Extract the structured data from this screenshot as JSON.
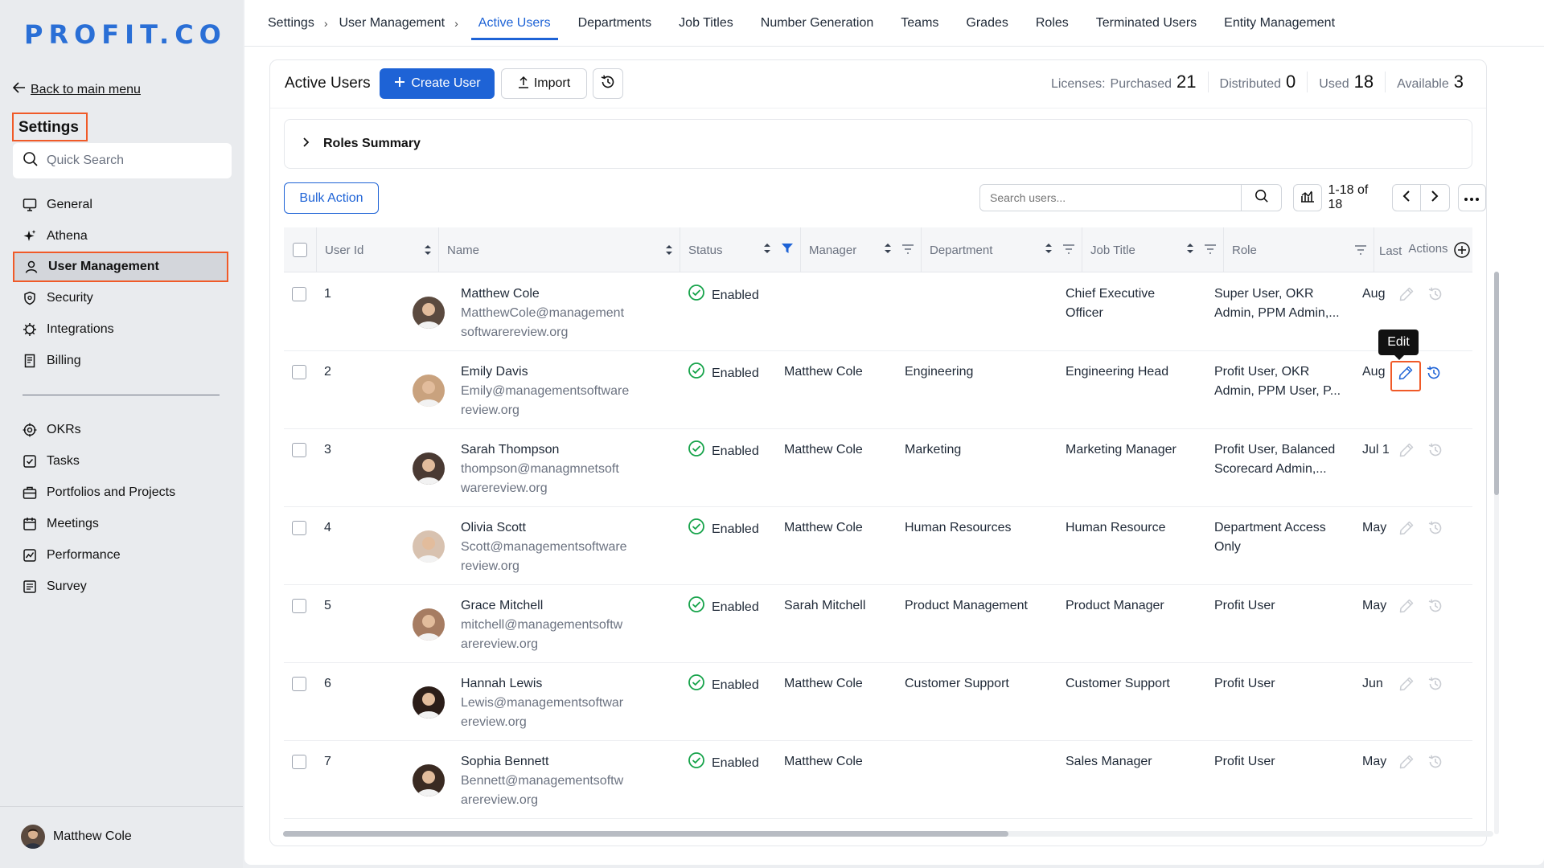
{
  "sidebar": {
    "logo": "PROFIT.CO",
    "back_label": "Back to main menu",
    "title": "Settings",
    "search_placeholder": "Quick Search",
    "items_top": [
      {
        "label": "General",
        "icon": "monitor-icon"
      },
      {
        "label": "Athena",
        "icon": "sparkle-icon"
      },
      {
        "label": "User Management",
        "icon": "user-icon",
        "active": true
      },
      {
        "label": "Security",
        "icon": "shield-icon"
      },
      {
        "label": "Integrations",
        "icon": "gear-icon"
      },
      {
        "label": "Billing",
        "icon": "receipt-icon"
      }
    ],
    "items_bottom": [
      {
        "label": "OKRs",
        "icon": "target-icon"
      },
      {
        "label": "Tasks",
        "icon": "checkbox-icon"
      },
      {
        "label": "Portfolios and Projects",
        "icon": "briefcase-icon"
      },
      {
        "label": "Meetings",
        "icon": "calendar-icon"
      },
      {
        "label": "Performance",
        "icon": "chart-icon"
      },
      {
        "label": "Survey",
        "icon": "survey-icon"
      }
    ],
    "footer_user": "Matthew Cole"
  },
  "breadcrumb": [
    "Settings",
    "User Management"
  ],
  "tabs": [
    {
      "label": "Active Users",
      "active": true
    },
    {
      "label": "Departments"
    },
    {
      "label": "Job Titles"
    },
    {
      "label": "Number Generation"
    },
    {
      "label": "Teams"
    },
    {
      "label": "Grades"
    },
    {
      "label": "Roles"
    },
    {
      "label": "Terminated Users"
    },
    {
      "label": "Entity Management"
    }
  ],
  "header": {
    "title": "Active Users",
    "create_label": "Create User",
    "import_label": "Import",
    "licenses_label": "Licenses:",
    "purchased_label": "Purchased",
    "purchased": "21",
    "distributed_label": "Distributed",
    "distributed": "0",
    "used_label": "Used",
    "used": "18",
    "available_label": "Available",
    "available": "3"
  },
  "roles_summary": "Roles Summary",
  "toolbar": {
    "bulk_action": "Bulk Action",
    "search_placeholder": "Search users...",
    "page_info": "1-18 of 18"
  },
  "columns": [
    "User Id",
    "Name",
    "Status",
    "Manager",
    "Department",
    "Job Title",
    "Role",
    "Last",
    "Actions"
  ],
  "rows": [
    {
      "id": "1",
      "name": "Matthew Cole",
      "email": [
        "MatthewCole@management",
        "softwarereview.org"
      ],
      "status": "Enabled",
      "manager": "",
      "department": "",
      "job_title": [
        "Chief Executive",
        "Officer"
      ],
      "role": [
        "Super User, OKR",
        "Admin, PPM Admin,..."
      ],
      "last": "Aug",
      "avatar_color": "#5b4a3f"
    },
    {
      "id": "2",
      "name": "Emily Davis",
      "email": [
        "Emily@managementsoftware",
        "review.org"
      ],
      "status": "Enabled",
      "manager": "Matthew Cole",
      "department": "Engineering",
      "job_title": [
        "Engineering Head"
      ],
      "role": [
        "Profit User, OKR",
        "Admin, PPM User, P..."
      ],
      "last": "Aug",
      "avatar_color": "#c9a27e",
      "edit_active": true
    },
    {
      "id": "3",
      "name": "Sarah Thompson",
      "email": [
        "thompson@managmnetsoft",
        "warereview.org"
      ],
      "status": "Enabled",
      "manager": "Matthew Cole",
      "department": "Marketing",
      "job_title": [
        "Marketing Manager"
      ],
      "role": [
        "Profit User, Balanced",
        "Scorecard Admin,..."
      ],
      "last": "Jul 1",
      "avatar_color": "#4a3a33"
    },
    {
      "id": "4",
      "name": "Olivia Scott",
      "email": [
        "Scott@managementsoftware",
        "review.org"
      ],
      "status": "Enabled",
      "manager": "Matthew Cole",
      "department": "Human Resources",
      "job_title": [
        "Human Resource"
      ],
      "role": [
        "Department Access",
        "Only"
      ],
      "last": "May",
      "avatar_color": "#d8c2b0"
    },
    {
      "id": "5",
      "name": "Grace Mitchell",
      "email": [
        "mitchell@managementsoftw",
        "arereview.org"
      ],
      "status": "Enabled",
      "manager": "Sarah Mitchell",
      "department": "Product Management",
      "job_title": [
        "Product Manager"
      ],
      "role": [
        "Profit User"
      ],
      "last": "May",
      "avatar_color": "#a67c62"
    },
    {
      "id": "6",
      "name": "Hannah Lewis",
      "email": [
        "Lewis@managementsoftwar",
        "ereview.org"
      ],
      "status": "Enabled",
      "manager": "Matthew Cole",
      "department": "Customer Support",
      "job_title": [
        "Customer Support"
      ],
      "role": [
        "Profit User"
      ],
      "last": "Jun",
      "avatar_color": "#2b1d18"
    },
    {
      "id": "7",
      "name": "Sophia Bennett",
      "email": [
        "Bennett@managementsoftw",
        "arereview.org"
      ],
      "status": "Enabled",
      "manager": "Matthew Cole",
      "department": "",
      "job_title": [
        "Sales Manager"
      ],
      "role": [
        "Profit User"
      ],
      "last": "May",
      "avatar_color": "#3a2a22"
    }
  ],
  "tooltip": "Edit",
  "colors": {
    "accent": "#1e63d6",
    "highlight": "#f05a28",
    "enabled": "#16a34a"
  }
}
